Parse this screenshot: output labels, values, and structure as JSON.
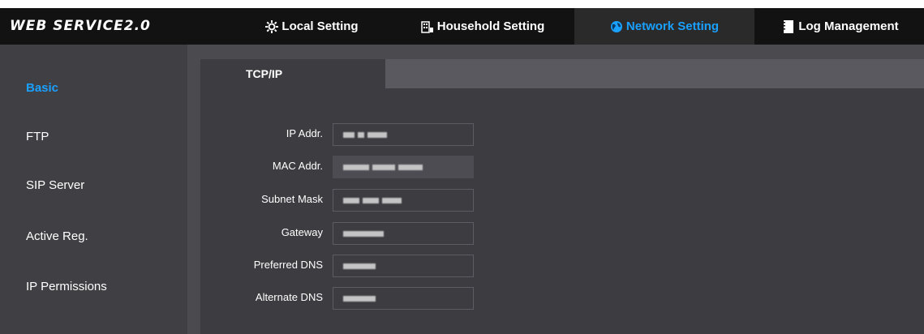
{
  "app": {
    "brand": "WEB SERVICE2.0"
  },
  "nav": [
    {
      "label": "Local Setting",
      "icon": "gear-icon"
    },
    {
      "label": "Household Setting",
      "icon": "building-icon"
    },
    {
      "label": "Network Setting",
      "icon": "globe-icon",
      "active": true
    },
    {
      "label": "Log Management",
      "icon": "log-icon"
    }
  ],
  "sidebar": {
    "items": [
      {
        "label": "Basic",
        "active": true
      },
      {
        "label": "FTP"
      },
      {
        "label": "SIP Server"
      },
      {
        "label": "Active Reg."
      },
      {
        "label": "IP Permissions"
      }
    ]
  },
  "tabs": [
    {
      "label": "TCP/IP",
      "active": true
    }
  ],
  "form": {
    "fields": [
      {
        "label": "IP Addr.",
        "value": "(redacted)"
      },
      {
        "label": "MAC Addr.",
        "value": "(redacted)",
        "readonly": true
      },
      {
        "label": "Subnet Mask",
        "value": "(redacted)"
      },
      {
        "label": "Gateway",
        "value": "(redacted)"
      },
      {
        "label": "Preferred DNS",
        "value": "(redacted)"
      },
      {
        "label": "Alternate DNS",
        "value": "(redacted)"
      }
    ]
  },
  "colors": {
    "accent": "#1aa0ff",
    "topbar": "#121212",
    "sidebar": "#3f3f44",
    "panel": "#3c3c41"
  }
}
